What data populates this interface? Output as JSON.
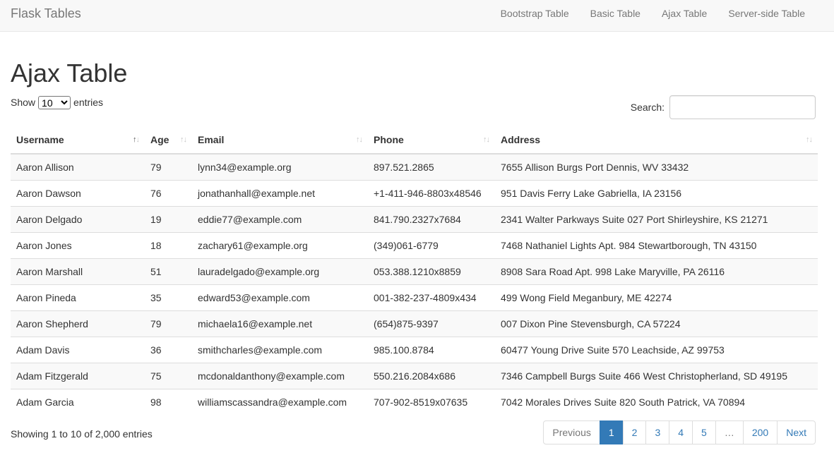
{
  "navbar": {
    "brand": "Flask Tables",
    "links": [
      "Bootstrap Table",
      "Basic Table",
      "Ajax Table",
      "Server-side Table"
    ]
  },
  "page": {
    "title": "Ajax Table"
  },
  "length": {
    "show_label": "Show",
    "selected": "10",
    "entries_label": "entries"
  },
  "search": {
    "label": "Search:",
    "value": ""
  },
  "table": {
    "columns": [
      "Username",
      "Age",
      "Email",
      "Phone",
      "Address"
    ],
    "sorted_column": "Username",
    "rows": [
      [
        "Aaron Allison",
        "79",
        "lynn34@example.org",
        "897.521.2865",
        "7655 Allison Burgs Port Dennis, WV 33432"
      ],
      [
        "Aaron Dawson",
        "76",
        "jonathanhall@example.net",
        "+1-411-946-8803x48546",
        "951 Davis Ferry Lake Gabriella, IA 23156"
      ],
      [
        "Aaron Delgado",
        "19",
        "eddie77@example.com",
        "841.790.2327x7684",
        "2341 Walter Parkways Suite 027 Port Shirleyshire, KS 21271"
      ],
      [
        "Aaron Jones",
        "18",
        "zachary61@example.org",
        "(349)061-6779",
        "7468 Nathaniel Lights Apt. 984 Stewartborough, TN 43150"
      ],
      [
        "Aaron Marshall",
        "51",
        "lauradelgado@example.org",
        "053.388.1210x8859",
        "8908 Sara Road Apt. 998 Lake Maryville, PA 26116"
      ],
      [
        "Aaron Pineda",
        "35",
        "edward53@example.com",
        "001-382-237-4809x434",
        "499 Wong Field Meganbury, ME 42274"
      ],
      [
        "Aaron Shepherd",
        "79",
        "michaela16@example.net",
        "(654)875-9397",
        "007 Dixon Pine Stevensburgh, CA 57224"
      ],
      [
        "Adam Davis",
        "36",
        "smithcharles@example.com",
        "985.100.8784",
        "60477 Young Drive Suite 570 Leachside, AZ 99753"
      ],
      [
        "Adam Fitzgerald",
        "75",
        "mcdonaldanthony@example.com",
        "550.216.2084x686",
        "7346 Campbell Burgs Suite 466 West Christopherland, SD 49195"
      ],
      [
        "Adam Garcia",
        "98",
        "williamscassandra@example.com",
        "707-902-8519x07635",
        "7042 Morales Drives Suite 820 South Patrick, VA 70894"
      ]
    ]
  },
  "info": "Showing 1 to 10 of 2,000 entries",
  "pagination": {
    "previous": "Previous",
    "pages": [
      "1",
      "2",
      "3",
      "4",
      "5",
      "…",
      "200"
    ],
    "active": "1",
    "next": "Next"
  },
  "colors": {
    "accent": "#337ab7",
    "navbar_bg": "#f8f8f8",
    "stripe": "#f9f9f9"
  }
}
